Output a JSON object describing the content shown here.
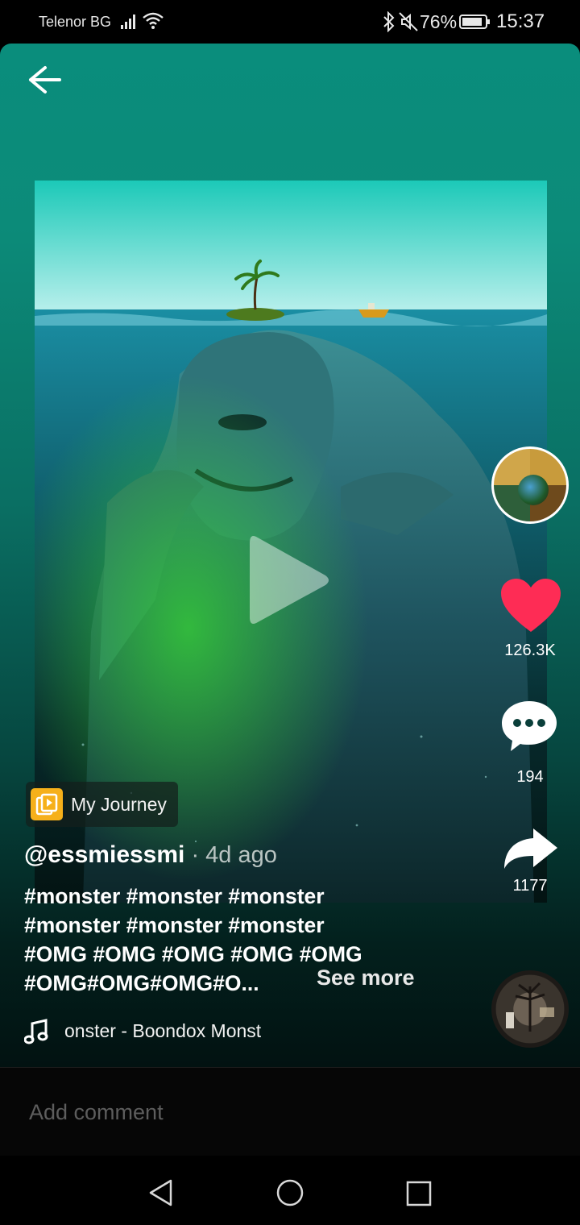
{
  "status_bar": {
    "carrier": "Telenor BG",
    "battery": "76%",
    "time": "15:37",
    "icons": [
      "signal-icon",
      "wifi-icon",
      "bluetooth-icon",
      "mute-icon",
      "battery-icon"
    ]
  },
  "video": {
    "playlist_label": "My Journey",
    "author": "@essmiessmi",
    "time_ago": " · 4d ago",
    "caption_lines": [
      "#monster #monster #monster",
      "#monster #monster #monster",
      "#OMG #OMG #OMG #OMG #OMG",
      "#OMG#OMG#OMG#O..."
    ],
    "see_more": "See more",
    "music_text": "onster - Boondox     Monst",
    "likes": "126.3K",
    "comments": "194",
    "shares": "1177",
    "accent_like": "#fe2c55"
  },
  "comment_bar": {
    "placeholder": "Add comment"
  }
}
